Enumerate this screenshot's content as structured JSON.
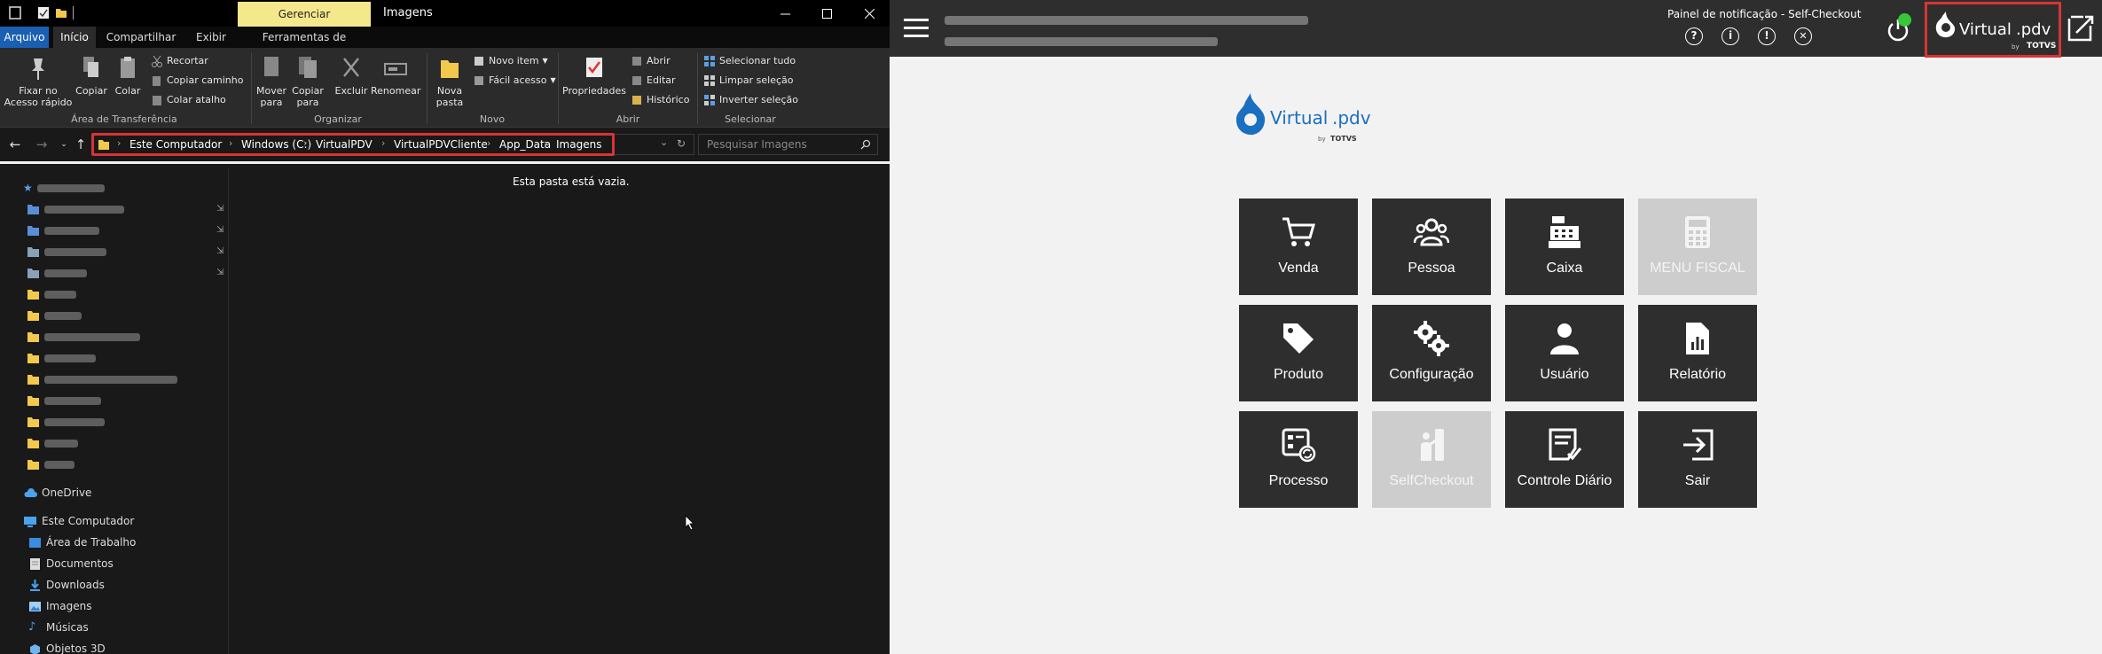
{
  "explorer": {
    "context_tab_group": "Gerenciar",
    "window_title": "Imagens",
    "window_controls": [
      "minimize-icon",
      "maximize-icon",
      "close-icon"
    ],
    "ribbon_tabs": [
      "Arquivo",
      "Início",
      "Compartilhar",
      "Exibir",
      "Ferramentas de Imagem"
    ],
    "ribbon": {
      "clipboard": {
        "pin": "Fixar no\nAcesso rápido",
        "copy": "Copiar",
        "paste": "Colar",
        "cut": "Recortar",
        "copy_path": "Copiar caminho",
        "paste_shortcut": "Colar atalho",
        "group_label": "Área de Transferência"
      },
      "organize": {
        "move_to": "Mover\npara",
        "copy_to": "Copiar\npara",
        "delete": "Excluir",
        "rename": "Renomear",
        "group_label": "Organizar"
      },
      "new": {
        "new_folder": "Nova\npasta",
        "new_item": "Novo item",
        "easy_access": "Fácil acesso",
        "group_label": "Novo"
      },
      "open": {
        "properties": "Propriedades",
        "open": "Abrir",
        "edit": "Editar",
        "history": "Histórico",
        "group_label": "Abrir"
      },
      "select": {
        "select_all": "Selecionar tudo",
        "clear_selection": "Limpar seleção",
        "invert_selection": "Inverter seleção",
        "group_label": "Selecionar"
      }
    },
    "breadcrumbs": [
      "Este Computador",
      "Windows (C:)",
      "VirtualPDV",
      "VirtualPDVCliente",
      "App_Data",
      "Imagens"
    ],
    "search_placeholder": "Pesquisar Imagens",
    "empty_message": "Esta pasta está vazia.",
    "nav_pane": {
      "onedrive": "OneDrive",
      "this_pc": "Este Computador",
      "this_pc_items": [
        "Área de Trabalho",
        "Documentos",
        "Downloads",
        "Imagens",
        "Músicas",
        "Objetos 3D"
      ]
    }
  },
  "pdv": {
    "notification_label": "Painel de notificação - Self-Checkout",
    "header_icons": [
      "help-icon",
      "info-icon",
      "alert-icon",
      "close-circle-icon"
    ],
    "header_logo": {
      "word": "Virtual",
      "suffix": ".pdv",
      "by": "by",
      "brand": "TOTVS"
    },
    "main_logo": {
      "word": "Virtual",
      "suffix": ".pdv",
      "by": "by",
      "brand": "TOTVS"
    },
    "status_color": "#37c837",
    "tiles": [
      {
        "label": "Venda",
        "icon": "cart-icon",
        "enabled": true
      },
      {
        "label": "Pessoa",
        "icon": "people-icon",
        "enabled": true
      },
      {
        "label": "Caixa",
        "icon": "cash-register-icon",
        "enabled": true
      },
      {
        "label": "MENU FISCAL",
        "icon": "calculator-icon",
        "enabled": false
      },
      {
        "label": "Produto",
        "icon": "tag-icon",
        "enabled": true
      },
      {
        "label": "Configuração",
        "icon": "gears-icon",
        "enabled": true
      },
      {
        "label": "Usuário",
        "icon": "user-icon",
        "enabled": true
      },
      {
        "label": "Relatório",
        "icon": "report-icon",
        "enabled": true
      },
      {
        "label": "Processo",
        "icon": "process-icon",
        "enabled": true
      },
      {
        "label": "SelfCheckout",
        "icon": "self-checkout-icon",
        "enabled": false
      },
      {
        "label": "Controle Diário",
        "icon": "daily-control-icon",
        "enabled": true
      },
      {
        "label": "Sair",
        "icon": "exit-icon",
        "enabled": true
      }
    ]
  }
}
